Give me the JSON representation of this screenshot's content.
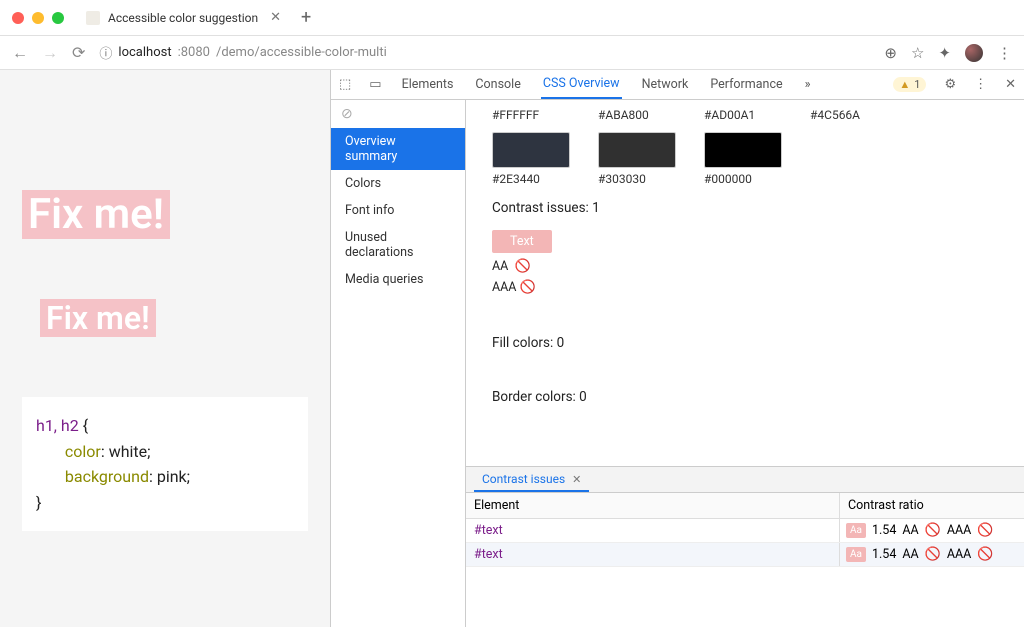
{
  "browser": {
    "tab_title": "Accessible color suggestion",
    "new_tab": "+",
    "url": {
      "scheme_icon": "ⓘ",
      "host": "localhost",
      "port": ":8080",
      "path": "/demo/accessible-color-multi"
    }
  },
  "page": {
    "h1": "Fix me!",
    "h2": "Fix me!",
    "code": {
      "selector": "h1, h2",
      "open": " {",
      "line1_prop": "color",
      "line1_val": ": white;",
      "line2_prop": "background",
      "line2_val": ": pink;",
      "close": "}"
    }
  },
  "devtools": {
    "tabs": {
      "elements": "Elements",
      "console": "Console",
      "cssoverview": "CSS Overview",
      "network": "Network",
      "performance": "Performance",
      "more": "»"
    },
    "warning_count": "1",
    "sidebar": {
      "overview": "Overview summary",
      "colors": "Colors",
      "font": "Font info",
      "unused": "Unused declarations",
      "media": "Media queries"
    },
    "swatches_top": [
      {
        "hex": "#FFFFFF",
        "bg": "#FFFFFF"
      },
      {
        "hex": "#ABA800",
        "bg": "#ABA800"
      },
      {
        "hex": "#AD00A1",
        "bg": "#AD00A1"
      },
      {
        "hex": "#4C566A",
        "bg": "#4C566A"
      }
    ],
    "swatches_bottom": [
      {
        "hex": "#2E3440",
        "bg": "#2E3440"
      },
      {
        "hex": "#303030",
        "bg": "#303030"
      },
      {
        "hex": "#000000",
        "bg": "#000000"
      }
    ],
    "contrast_heading": "Contrast issues: 1",
    "text_btn": "Text",
    "aa": "AA",
    "aaa": "AAA",
    "fill": "Fill colors: 0",
    "border": "Border colors: 0",
    "drawer_tab": "Contrast issues",
    "table": {
      "col_element": "Element",
      "col_ratio": "Contrast ratio",
      "rows": [
        {
          "el": "#text",
          "badge": "Aa",
          "ratio": "1.54",
          "aa": "AA",
          "aaa": "AAA"
        },
        {
          "el": "#text",
          "badge": "Aa",
          "ratio": "1.54",
          "aa": "AA",
          "aaa": "AAA"
        }
      ]
    }
  }
}
